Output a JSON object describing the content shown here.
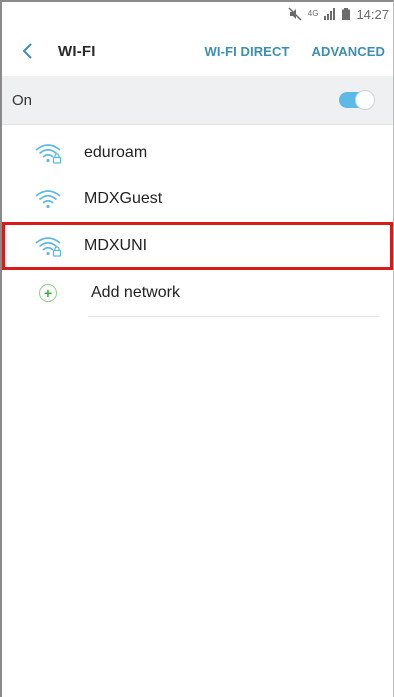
{
  "status_bar": {
    "network_type": "4G",
    "time": "14:27",
    "icons": [
      "mute-icon",
      "network-4g-icon",
      "signal-icon",
      "battery-icon"
    ]
  },
  "app_bar": {
    "title": "WI-FI",
    "actions": [
      "WI-FI DIRECT",
      "ADVANCED"
    ]
  },
  "toggle_row": {
    "label": "On",
    "state": true
  },
  "networks": [
    {
      "name": "eduroam",
      "secured": true
    },
    {
      "name": "MDXGuest",
      "secured": false
    },
    {
      "name": "MDXUNI",
      "secured": true,
      "highlighted": true
    }
  ],
  "add_network_label": "Add network",
  "colors": {
    "accent": "#3c8fb4",
    "wifi_icon": "#5db9e5",
    "toggle": "#5db9e5",
    "highlight": "#d71b1b",
    "add_green": "#3fae3a"
  }
}
